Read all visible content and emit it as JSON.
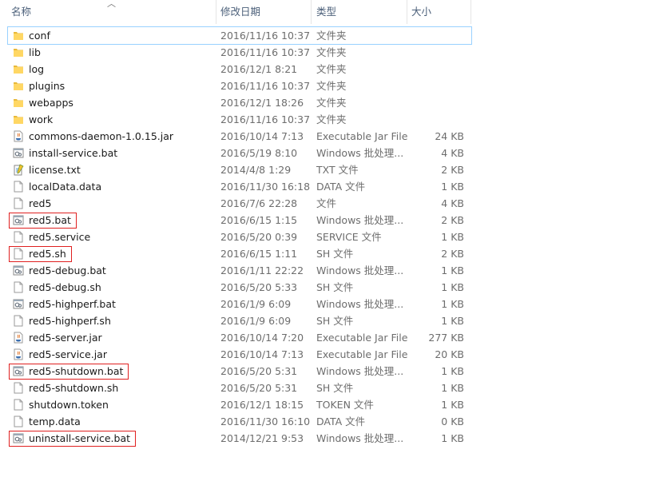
{
  "columns": {
    "name": "名称",
    "date": "修改日期",
    "type": "类型",
    "size": "大小"
  },
  "files": [
    {
      "name": "conf",
      "date": "2016/11/16 10:37",
      "type": "文件夹",
      "size": "",
      "icon": "folder-icon"
    },
    {
      "name": "lib",
      "date": "2016/11/16 10:37",
      "type": "文件夹",
      "size": "",
      "icon": "folder-icon"
    },
    {
      "name": "log",
      "date": "2016/12/1 8:21",
      "type": "文件夹",
      "size": "",
      "icon": "folder-icon"
    },
    {
      "name": "plugins",
      "date": "2016/11/16 10:37",
      "type": "文件夹",
      "size": "",
      "icon": "folder-icon"
    },
    {
      "name": "webapps",
      "date": "2016/12/1 18:26",
      "type": "文件夹",
      "size": "",
      "icon": "folder-icon"
    },
    {
      "name": "work",
      "date": "2016/11/16 10:37",
      "type": "文件夹",
      "size": "",
      "icon": "folder-icon"
    },
    {
      "name": "commons-daemon-1.0.15.jar",
      "date": "2016/10/14 7:13",
      "type": "Executable Jar File",
      "size": "24 KB",
      "icon": "jar-icon"
    },
    {
      "name": "install-service.bat",
      "date": "2016/5/19 8:10",
      "type": "Windows 批处理...",
      "size": "4 KB",
      "icon": "batch-file-icon"
    },
    {
      "name": "license.txt",
      "date": "2014/4/8 1:29",
      "type": "TXT 文件",
      "size": "2 KB",
      "icon": "text-file-icon"
    },
    {
      "name": "localData.data",
      "date": "2016/11/30 16:18",
      "type": "DATA 文件",
      "size": "1 KB",
      "icon": "file-icon"
    },
    {
      "name": "red5",
      "date": "2016/7/6 22:28",
      "type": "文件",
      "size": "4 KB",
      "icon": "file-icon"
    },
    {
      "name": "red5.bat",
      "date": "2016/6/15 1:15",
      "type": "Windows 批处理...",
      "size": "2 KB",
      "icon": "batch-file-icon"
    },
    {
      "name": "red5.service",
      "date": "2016/5/20 0:39",
      "type": "SERVICE 文件",
      "size": "1 KB",
      "icon": "file-icon"
    },
    {
      "name": "red5.sh",
      "date": "2016/6/15 1:11",
      "type": "SH 文件",
      "size": "2 KB",
      "icon": "file-icon"
    },
    {
      "name": "red5-debug.bat",
      "date": "2016/1/11 22:22",
      "type": "Windows 批处理...",
      "size": "1 KB",
      "icon": "batch-file-icon"
    },
    {
      "name": "red5-debug.sh",
      "date": "2016/5/20 5:33",
      "type": "SH 文件",
      "size": "1 KB",
      "icon": "file-icon"
    },
    {
      "name": "red5-highperf.bat",
      "date": "2016/1/9 6:09",
      "type": "Windows 批处理...",
      "size": "1 KB",
      "icon": "batch-file-icon"
    },
    {
      "name": "red5-highperf.sh",
      "date": "2016/1/9 6:09",
      "type": "SH 文件",
      "size": "1 KB",
      "icon": "file-icon"
    },
    {
      "name": "red5-server.jar",
      "date": "2016/10/14 7:20",
      "type": "Executable Jar File",
      "size": "277 KB",
      "icon": "jar-icon"
    },
    {
      "name": "red5-service.jar",
      "date": "2016/10/14 7:13",
      "type": "Executable Jar File",
      "size": "20 KB",
      "icon": "jar-icon"
    },
    {
      "name": "red5-shutdown.bat",
      "date": "2016/5/20 5:31",
      "type": "Windows 批处理...",
      "size": "1 KB",
      "icon": "batch-file-icon"
    },
    {
      "name": "red5-shutdown.sh",
      "date": "2016/5/20 5:31",
      "type": "SH 文件",
      "size": "1 KB",
      "icon": "file-icon"
    },
    {
      "name": "shutdown.token",
      "date": "2016/12/1 18:15",
      "type": "TOKEN 文件",
      "size": "1 KB",
      "icon": "file-icon"
    },
    {
      "name": "temp.data",
      "date": "2016/11/30 16:10",
      "type": "DATA 文件",
      "size": "0 KB",
      "icon": "file-icon"
    },
    {
      "name": "uninstall-service.bat",
      "date": "2014/12/21 9:53",
      "type": "Windows 批处理...",
      "size": "1 KB",
      "icon": "batch-file-icon"
    }
  ],
  "highlighted_files": [
    "red5.bat",
    "red5.sh",
    "red5-shutdown.bat",
    "uninstall-service.bat"
  ],
  "selected_file": "conf",
  "colors": {
    "highlight": "#e02020",
    "selection": "#99d1ff",
    "folder": "#ffd764",
    "header_text": "#4c607a"
  }
}
